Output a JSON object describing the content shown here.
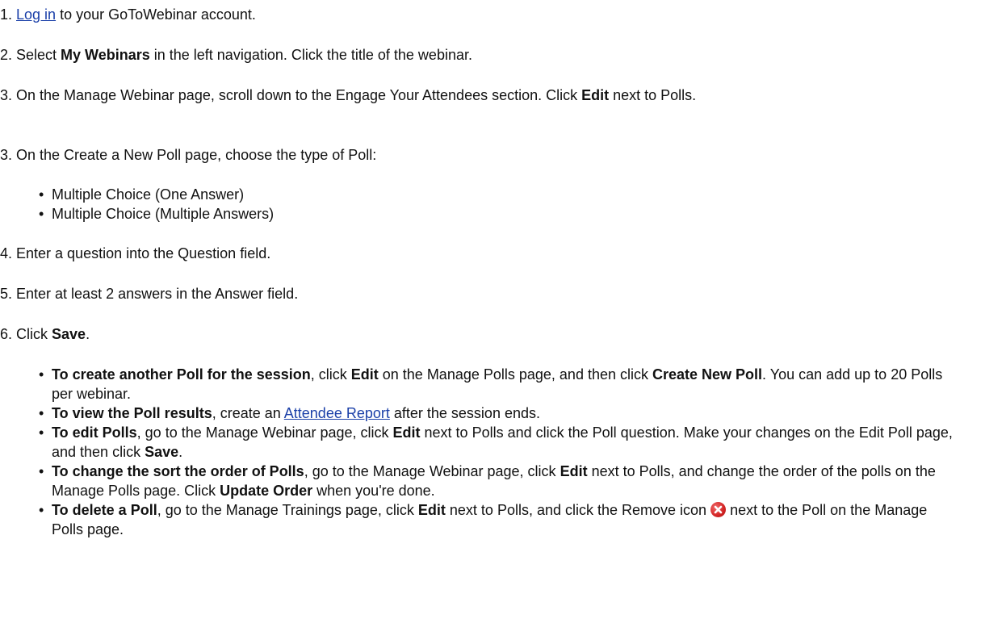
{
  "steps": {
    "s1": {
      "num": "1. ",
      "link": "Log in",
      "after": " to your GoToWebinar account."
    },
    "s2": {
      "pre": "2. Select ",
      "bold": "My Webinars",
      "after": " in the left navigation. Click the title of the webinar."
    },
    "s3a": {
      "pre": "3. On the Manage Webinar page, scroll down to the Engage Your Attendees section. Click ",
      "bold": "Edit",
      "after": " next to Polls."
    },
    "s3b": {
      "text": "3. On the Create a New Poll page, choose the type of Poll:"
    },
    "s4": {
      "text": "4. Enter a question into the Question field."
    },
    "s5": {
      "text": "5. Enter at least 2 answers in the Answer field."
    },
    "s6": {
      "pre": "6. Click ",
      "bold": "Save",
      "after": "."
    }
  },
  "poll_types": [
    "Multiple Choice (One Answer)",
    "Multiple Choice (Multiple Answers)"
  ],
  "tips": {
    "t1": {
      "lead": "To create another Poll for the session",
      "a": ", click ",
      "b1": "Edit",
      "c": " on the Manage Polls page, and then click ",
      "b2": "Create New Poll",
      "d": ". You can add up to 20 Polls per webinar."
    },
    "t2": {
      "lead": "To view the Poll results",
      "a": ", create an ",
      "link": "Attendee Report",
      "b": " after the session ends."
    },
    "t3": {
      "lead": "To edit Polls",
      "a": ", go to the Manage Webinar page, click ",
      "b1": "Edit",
      "c": " next to Polls and click the Poll question. Make your changes on the Edit Poll page, and then click ",
      "b2": "Save",
      "d": "."
    },
    "t4": {
      "lead": "To change the sort the order of Polls",
      "a": ", go to the Manage Webinar page, click ",
      "b1": "Edit",
      "c": " next to Polls, and change the order of the polls on the Manage Polls page. Click ",
      "b2": "Update Order",
      "d": " when you're done."
    },
    "t5": {
      "lead": "To delete a Poll",
      "a": ", go to the Manage Trainings page, click ",
      "b1": "Edit",
      "c": " next to Polls, and click the Remove icon ",
      "d": " next to the Poll on the Manage Polls page."
    }
  },
  "bullet_char": "•",
  "colors": {
    "link": "#1a3fa8",
    "remove_icon": "#d32424"
  }
}
